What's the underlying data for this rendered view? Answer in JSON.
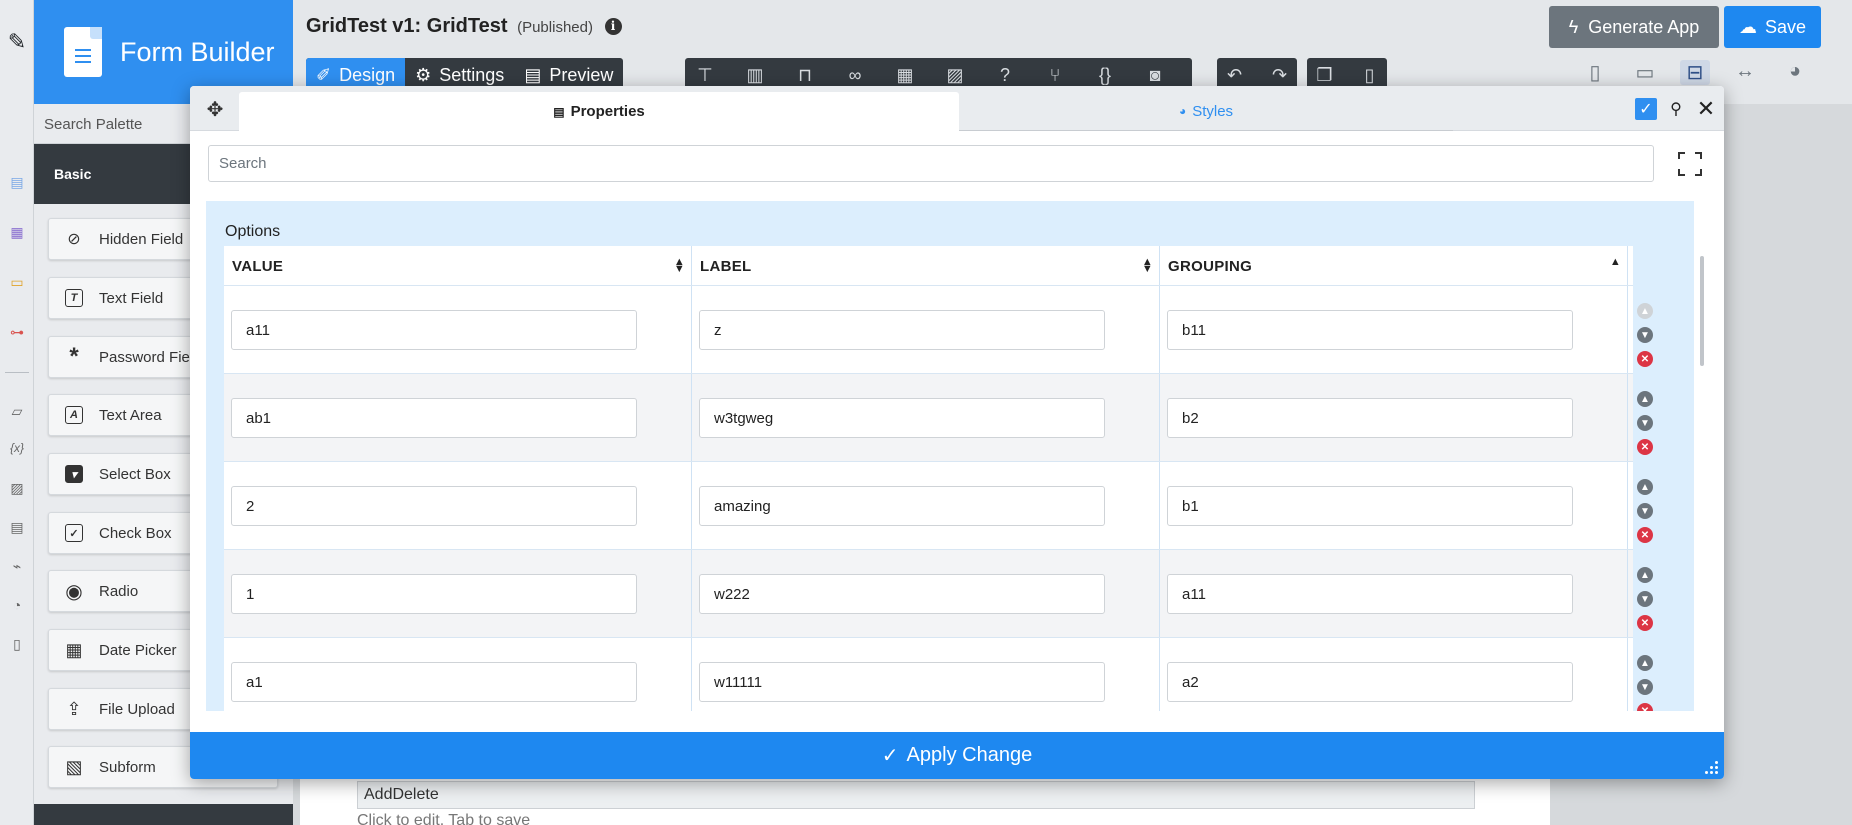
{
  "brand": {
    "title": "Form Builder"
  },
  "palette": {
    "search_placeholder": "Search Palette",
    "category": "Basic",
    "items": [
      {
        "label": "Hidden Field",
        "icon": "eye-off-icon"
      },
      {
        "label": "Text Field",
        "icon": "text-field-icon"
      },
      {
        "label": "Password Field",
        "icon": "asterisk-icon"
      },
      {
        "label": "Text Area",
        "icon": "text-area-icon"
      },
      {
        "label": "Select Box",
        "icon": "select-box-icon"
      },
      {
        "label": "Check Box",
        "icon": "checkbox-icon"
      },
      {
        "label": "Radio",
        "icon": "radio-icon"
      },
      {
        "label": "Date Picker",
        "icon": "calendar-icon"
      },
      {
        "label": "File Upload",
        "icon": "upload-icon"
      },
      {
        "label": "Subform",
        "icon": "subform-icon"
      }
    ]
  },
  "header": {
    "title": "GridTest v1: GridTest",
    "status": "(Published)",
    "tabs": [
      {
        "label": "Design",
        "active": true
      },
      {
        "label": "Settings",
        "active": false
      },
      {
        "label": "Preview",
        "active": false
      }
    ],
    "generate_label": "Generate App",
    "save_label": "Save"
  },
  "canvas": {
    "field_value": "AddDelete",
    "hint": "Click to edit. Tab to save"
  },
  "dialog": {
    "tabs": [
      {
        "label": "Properties",
        "active": true
      },
      {
        "label": "Styles",
        "active": false
      }
    ],
    "search_placeholder": "Search",
    "options_label": "Options",
    "columns": [
      "VALUE",
      "LABEL",
      "GROUPING"
    ],
    "rows": [
      {
        "value": "a11",
        "label": "z",
        "grouping": "b11"
      },
      {
        "value": "ab1",
        "label": "w3tgweg",
        "grouping": "b2"
      },
      {
        "value": "2",
        "label": "amazing",
        "grouping": "b1"
      },
      {
        "value": "1",
        "label": "w222",
        "grouping": "a11"
      },
      {
        "value": "a1",
        "label": "w11111",
        "grouping": "a2"
      }
    ],
    "apply_label": "Apply Change"
  },
  "colors": {
    "primary": "#1e88f0",
    "sidebar_dark": "#343a40",
    "options_bg": "#dceefd",
    "danger": "#dc3545"
  }
}
